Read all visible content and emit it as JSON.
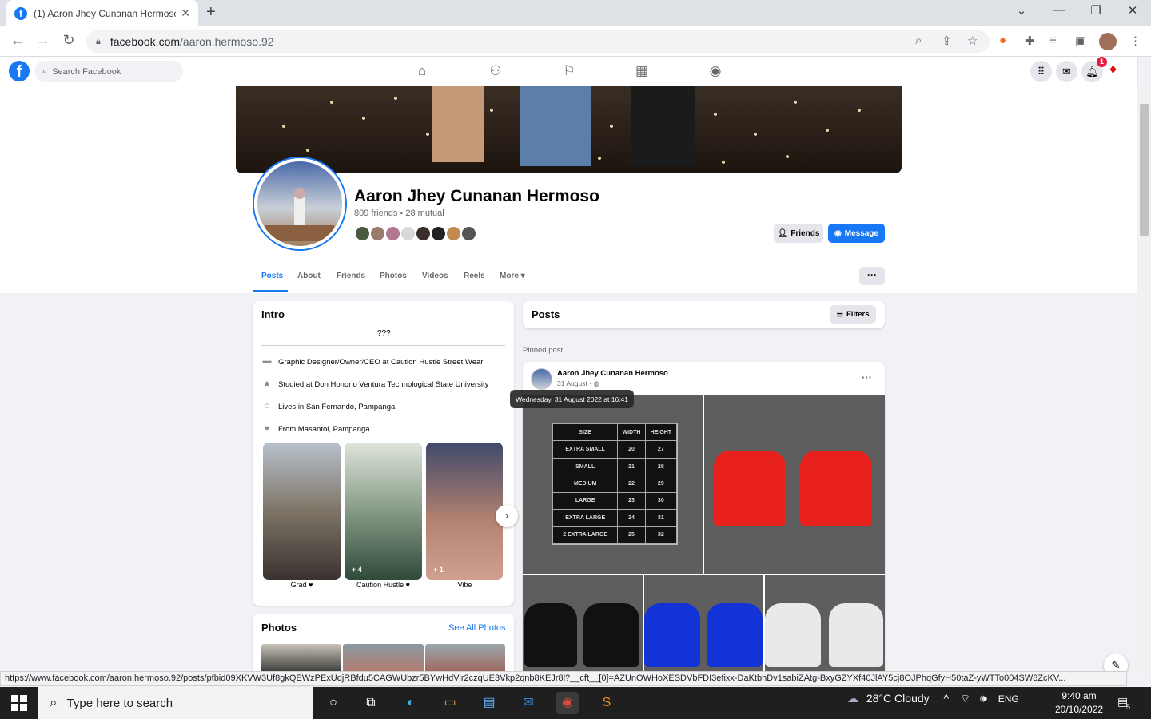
{
  "browser": {
    "tab_title": "(1) Aaron Jhey Cunanan Hermoso",
    "tab_close": "✕",
    "new_tab": "+",
    "url_host": "facebook.com",
    "url_path": "/aaron.hermoso.92"
  },
  "fb_header": {
    "logo": "f",
    "search_placeholder": "Search Facebook",
    "notification_count": "1"
  },
  "profile": {
    "name": "Aaron Jhey Cunanan Hermoso",
    "friends_line": "809 friends • 28 mutual",
    "friends_button": "Friends",
    "message_button": "Message",
    "tabs": [
      "Posts",
      "About",
      "Friends",
      "Photos",
      "Videos",
      "Reels",
      "More ▾"
    ],
    "more_dots": "···"
  },
  "intro": {
    "title": "Intro",
    "bio": "???",
    "items": [
      {
        "icon": "briefcase-icon",
        "text": "Graphic Designer/Owner/CEO at Caution Hustle Street Wear"
      },
      {
        "icon": "graduation-cap-icon",
        "text": "Studied at Don Honorio Ventura Technological State University"
      },
      {
        "icon": "home-icon",
        "text": "Lives in San Fernando, Pampanga"
      },
      {
        "icon": "location-pin-icon",
        "text": "From Masantol, Pampanga"
      }
    ],
    "featured": [
      {
        "label": "Grad ♥",
        "extra": ""
      },
      {
        "label": "Caution Hustle ♥",
        "extra": "+ 4"
      },
      {
        "label": "Vibe",
        "extra": "+ 1"
      }
    ]
  },
  "photos": {
    "title": "Photos",
    "see_all": "See All Photos"
  },
  "posts": {
    "title": "Posts",
    "filters": "Filters",
    "pinned_label": "Pinned post",
    "post_author": "Aaron Jhey Cunanan Hermoso",
    "post_date": "31 August · ",
    "tooltip": "Wednesday, 31 August 2022 at 16:41",
    "size_chart": {
      "headers": [
        "SIZE",
        "WIDTH",
        "HEIGHT"
      ],
      "rows": [
        [
          "EXTRA SMALL",
          "20",
          "27"
        ],
        [
          "SMALL",
          "21",
          "28"
        ],
        [
          "MEDIUM",
          "22",
          "29"
        ],
        [
          "LARGE",
          "23",
          "30"
        ],
        [
          "EXTRA LARGE",
          "24",
          "31"
        ],
        [
          "2 EXTRA LARGE",
          "25",
          "32"
        ]
      ]
    }
  },
  "status_url": "https://www.facebook.com/aaron.hermoso.92/posts/pfbid09XKVW3Uf8gkQEWzPExUdjRBfdu5CAGWUbzr5BYwHdVir2czqUE3Vkp2qnb8KEJr8l?__cft__[0]=AZUnOWHoXESDVbFDI3efixx-DaKtbhDv1sabiZAtg-BxyGZYXf40JlAY5cj8OJPhqGfyH50taZ-yWTTo004SW8ZcKV...",
  "taskbar": {
    "search_placeholder": "Type here to search",
    "weather": "28°C  Cloudy",
    "lang": "ENG",
    "time": "9:40 am",
    "date": "20/10/2022",
    "notif": "5"
  },
  "colors": {
    "accent": "#1877f2",
    "shirt_red": "#e8211d",
    "shirt_blue": "#1433d6",
    "shirt_black": "#111111",
    "shirt_white": "#e9e9e9"
  }
}
